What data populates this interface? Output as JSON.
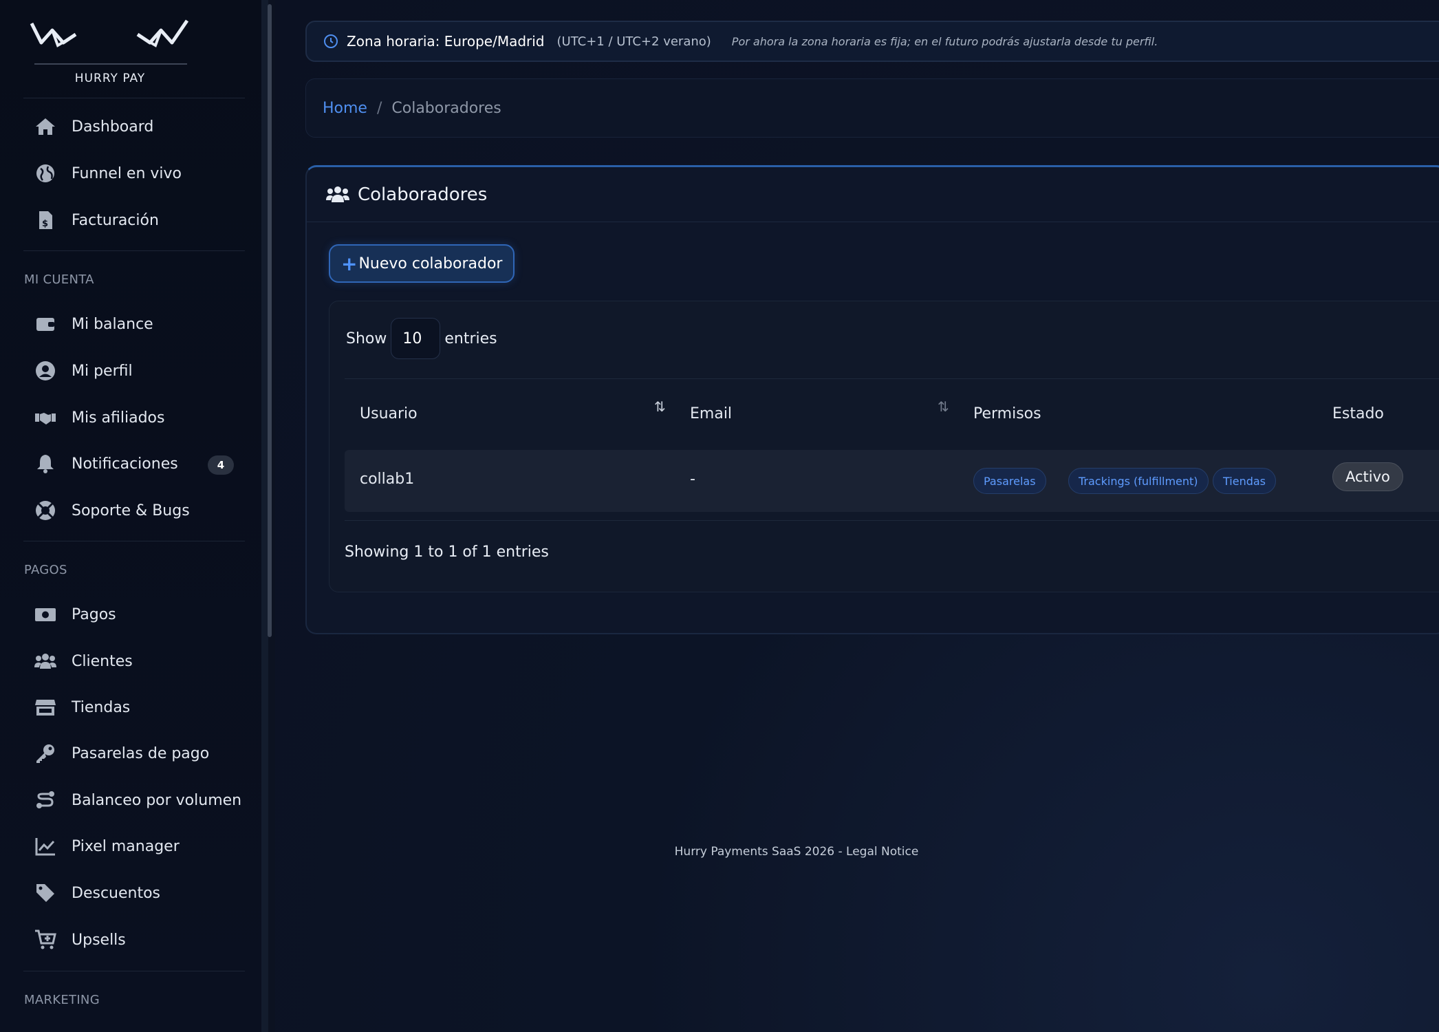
{
  "brand": {
    "name": "HURRY PAY"
  },
  "sidebar": {
    "top_items": [
      {
        "label": "Dashboard",
        "icon": "home-icon"
      },
      {
        "label": "Funnel en vivo",
        "icon": "globe-icon"
      },
      {
        "label": "Facturación",
        "icon": "invoice-icon"
      }
    ],
    "sections": [
      {
        "title": "MI CUENTA",
        "items": [
          {
            "label": "Mi balance",
            "icon": "wallet-icon"
          },
          {
            "label": "Mi perfil",
            "icon": "user-circle-icon"
          },
          {
            "label": "Mis afiliados",
            "icon": "handshake-icon"
          },
          {
            "label": "Notificaciones",
            "icon": "bell-icon",
            "badge": "4"
          },
          {
            "label": "Soporte & Bugs",
            "icon": "lifebuoy-icon"
          }
        ]
      },
      {
        "title": "PAGOS",
        "items": [
          {
            "label": "Pagos",
            "icon": "money-icon"
          },
          {
            "label": "Clientes",
            "icon": "users-icon"
          },
          {
            "label": "Tiendas",
            "icon": "store-icon"
          },
          {
            "label": "Pasarelas de pago",
            "icon": "key-icon"
          },
          {
            "label": "Balanceo por volumen",
            "icon": "route-icon"
          },
          {
            "label": "Pixel manager",
            "icon": "chart-line-icon"
          },
          {
            "label": "Descuentos",
            "icon": "tag-icon"
          },
          {
            "label": "Upsells",
            "icon": "cart-plus-icon"
          }
        ]
      },
      {
        "title": "MARKETING",
        "items": []
      }
    ]
  },
  "timezone": {
    "title": "Zona horaria: Europe/Madrid",
    "offset": "(UTC+1 / UTC+2 verano)",
    "note": "Por ahora la zona horaria es fija; en el futuro podrás ajustarla desde tu perfil.",
    "icon": "clock-icon"
  },
  "breadcrumb": {
    "home": "Home",
    "separator": "/",
    "current": "Colaboradores"
  },
  "card": {
    "title": "Colaboradores",
    "icon": "users-icon",
    "new_button": {
      "plus": "+",
      "label": "Nuevo colaborador"
    }
  },
  "table": {
    "show_label": "Show",
    "entries_label": "entries",
    "page_length": "10",
    "columns": [
      "Usuario",
      "Email",
      "Permisos",
      "Estado"
    ],
    "sort_icon": "⇅",
    "rows": [
      {
        "usuario": "collab1",
        "email": "-",
        "permisos": [
          "Pasarelas",
          "Trackings (fulfillment)",
          "Tiendas"
        ],
        "estado": "Activo"
      }
    ],
    "info": "Showing 1 to 1 of 1 entries"
  },
  "footer": {
    "text": "Hurry Payments SaaS 2026 - Legal Notice"
  },
  "colors": {
    "accent": "#4f8ff0",
    "background": "#0c1221",
    "pill_text": "#5f9cff"
  }
}
